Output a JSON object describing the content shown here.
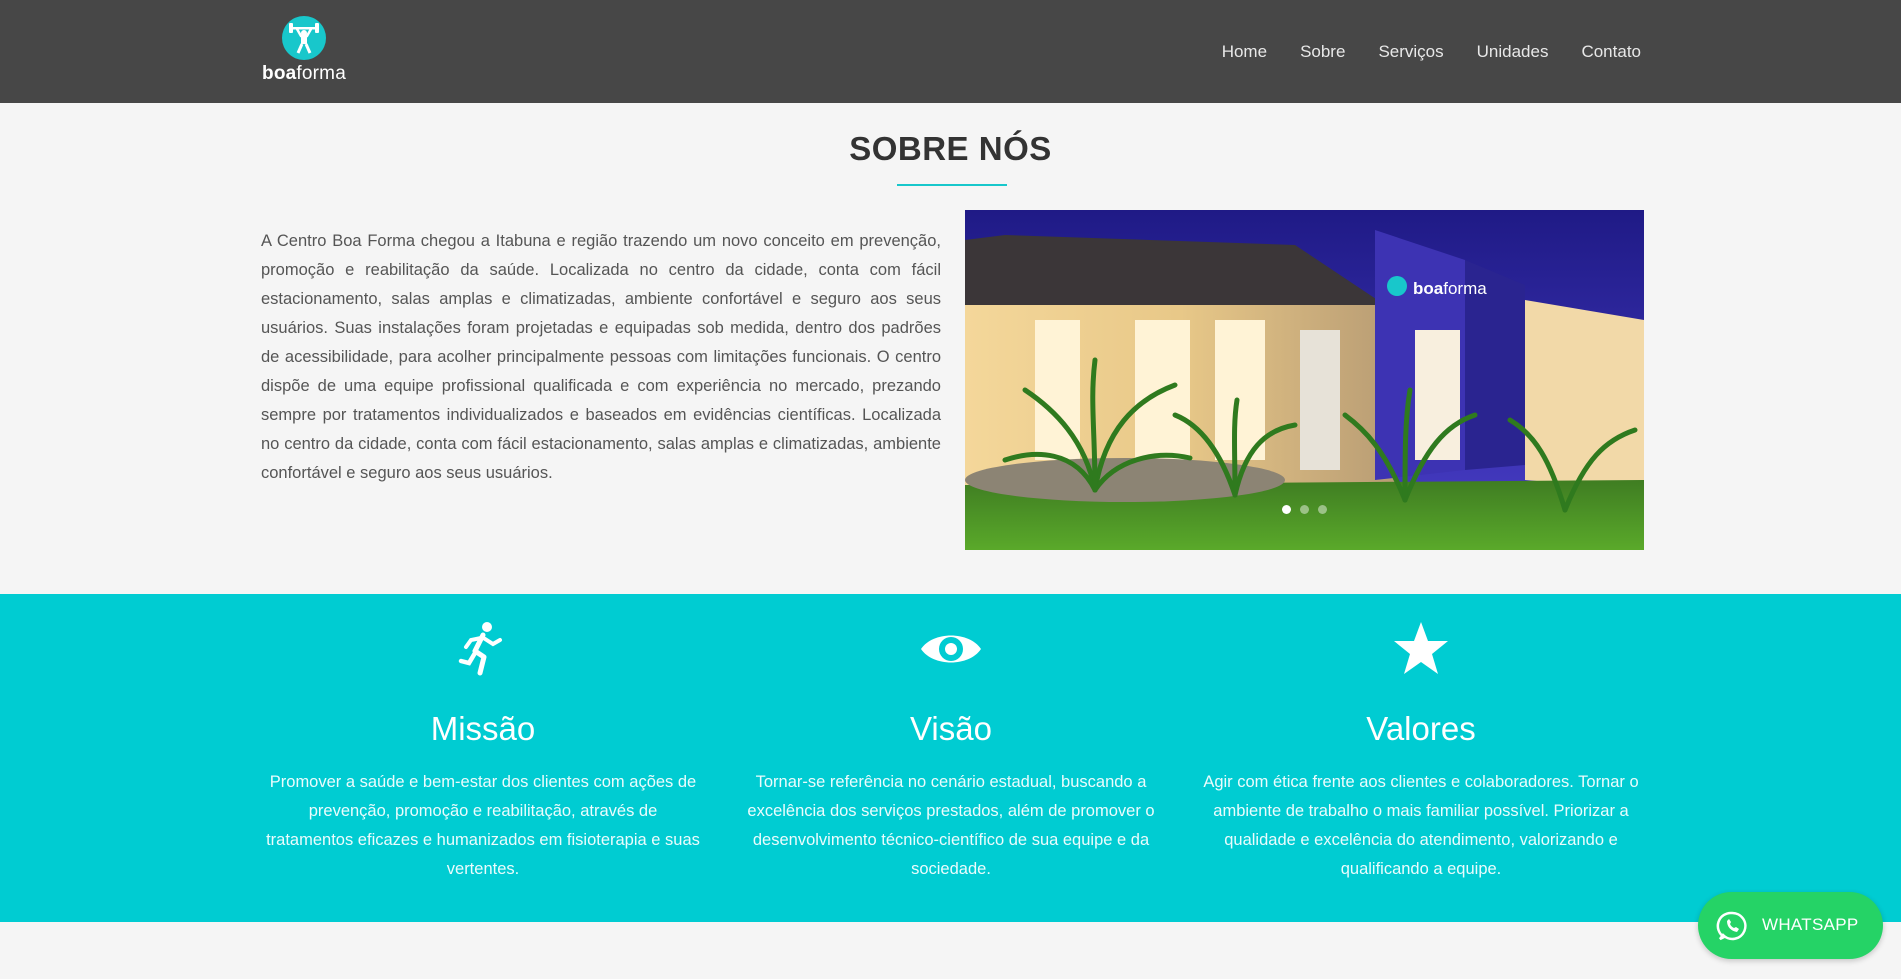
{
  "header": {
    "logo_bold": "boa",
    "logo_light": "forma",
    "nav": [
      "Home",
      "Sobre",
      "Serviços",
      "Unidades",
      "Contato"
    ]
  },
  "about": {
    "title": "SOBRE NÓS",
    "text": "A Centro Boa Forma chegou a Itabuna e região trazendo um novo conceito em prevenção, promoção e reabilitação da saúde. Localizada no centro da cidade, conta com fácil estacionamento, salas amplas e climatizadas, ambiente confortável e seguro aos seus usuários. Suas instalações foram projetadas e equipadas sob medida, dentro dos padrões de acessibilidade, para acolher principalmente pessoas com limitações funcionais. O centro dispõe de uma equipe profissional qualificada e com experiência no mercado, prezando sempre por tratamentos individualizados e baseados em evidências científicas. Localizada no centro da cidade, conta com fácil estacionamento, salas amplas e climatizadas, ambiente confortável e seguro aos seus usuários.",
    "carousel": {
      "sign_bold": "boa",
      "sign_light": "forma",
      "slides": 3,
      "active_slide": 1
    }
  },
  "values": {
    "items": [
      {
        "icon": "running-person-icon",
        "title": "Missão",
        "text": "Promover a saúde e bem-estar dos clientes com ações de prevenção, promoção e reabilitação, através de tratamentos eficazes e humanizados em fisioterapia e suas vertentes."
      },
      {
        "icon": "eye-icon",
        "title": "Visão",
        "text": "Tornar-se referência no cenário estadual, buscando a excelência dos serviços prestados, além de promover o desenvolvimento técnico-científico de sua equipe e da sociedade."
      },
      {
        "icon": "star-icon",
        "title": "Valores",
        "text": "Agir com ética frente aos clientes e colaboradores. Tornar o ambiente de trabalho o mais familiar possível. Priorizar a qualidade e excelência do atendimento, valorizando e qualificando a equipe."
      }
    ]
  },
  "whatsapp": {
    "label": "WHATSAPP",
    "icon": "whatsapp-icon"
  },
  "colors": {
    "header_bg": "#474747",
    "accent": "#00ccd2",
    "whatsapp": "#25d366"
  }
}
